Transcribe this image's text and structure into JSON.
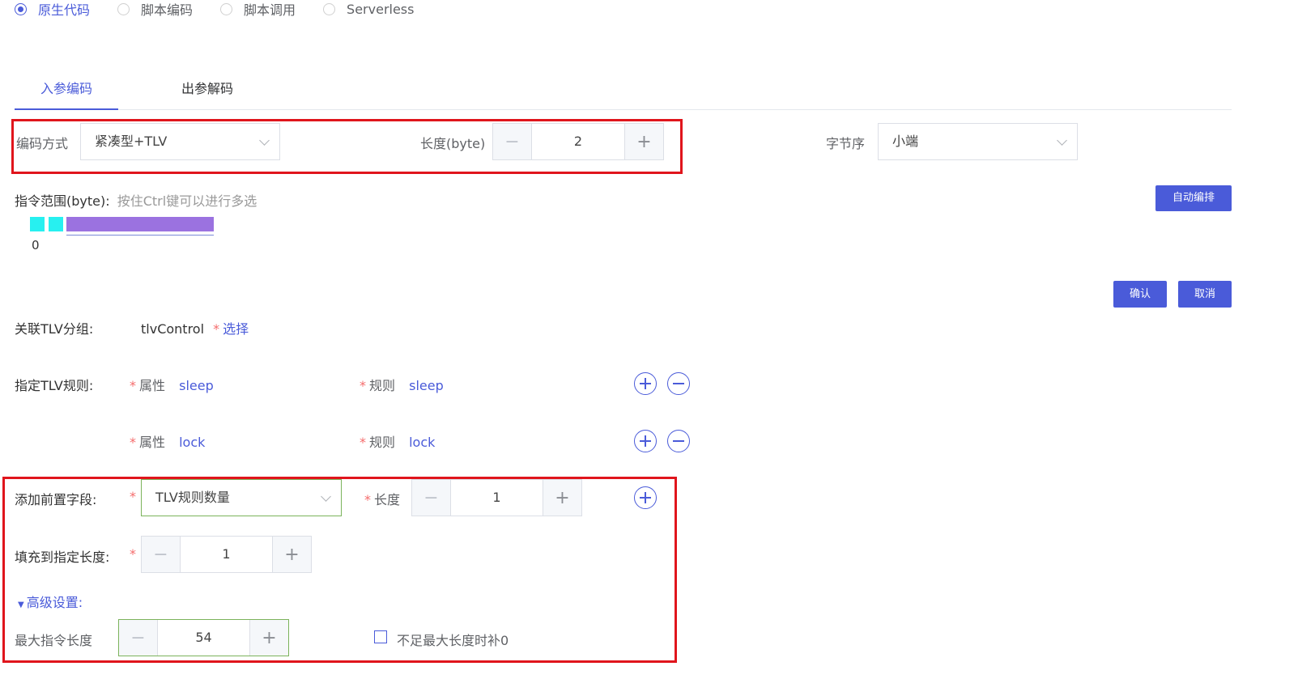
{
  "mode_radios": [
    {
      "label": "原生代码",
      "checked": true
    },
    {
      "label": "脚本编码",
      "checked": false
    },
    {
      "label": "脚本调用",
      "checked": false
    },
    {
      "label": "Serverless",
      "checked": false
    }
  ],
  "tabs": [
    {
      "label": "入参编码",
      "active": true
    },
    {
      "label": "出参解码",
      "active": false
    }
  ],
  "encoding": {
    "method_label": "编码方式",
    "method_value": "紧凑型+TLV",
    "length_label": "长度(byte)",
    "length_value": "2",
    "byte_order_label": "字节序",
    "byte_order_value": "小端"
  },
  "instruction_range": {
    "label": "指令范围(byte):",
    "hint": "按住Ctrl键可以进行多选",
    "start_index": "0",
    "auto_arrange_button": "自动编排"
  },
  "actions": {
    "confirm": "确认",
    "cancel": "取消"
  },
  "tlv_group": {
    "label": "关联TLV分组:",
    "value": "tlvControl",
    "required_mark": "*",
    "select_link": "选择"
  },
  "tlv_rules": {
    "label": "指定TLV规则:",
    "required_mark": "*",
    "attr_label": "属性",
    "rule_label": "规则",
    "rows": [
      {
        "attr": "sleep",
        "rule": "sleep"
      },
      {
        "attr": "lock",
        "rule": "lock"
      }
    ]
  },
  "prefix_field": {
    "label": "添加前置字段:",
    "required_mark": "*",
    "select_value": "TLV规则数量",
    "length_label": "长度",
    "length_value": "1"
  },
  "fill_length": {
    "label": "填充到指定长度:",
    "required_mark": "*",
    "value": "1"
  },
  "advanced": {
    "toggle_label": "高级设置:",
    "max_length_label": "最大指令长度",
    "max_length_value": "54",
    "pad_checkbox_label": "不足最大长度时补0",
    "pad_checked": false
  },
  "colors": {
    "accent": "#4a5bd9",
    "highlight_box": "#e0151c",
    "range_byte": "#27f0f0",
    "range_bar": "#9b72e0"
  }
}
